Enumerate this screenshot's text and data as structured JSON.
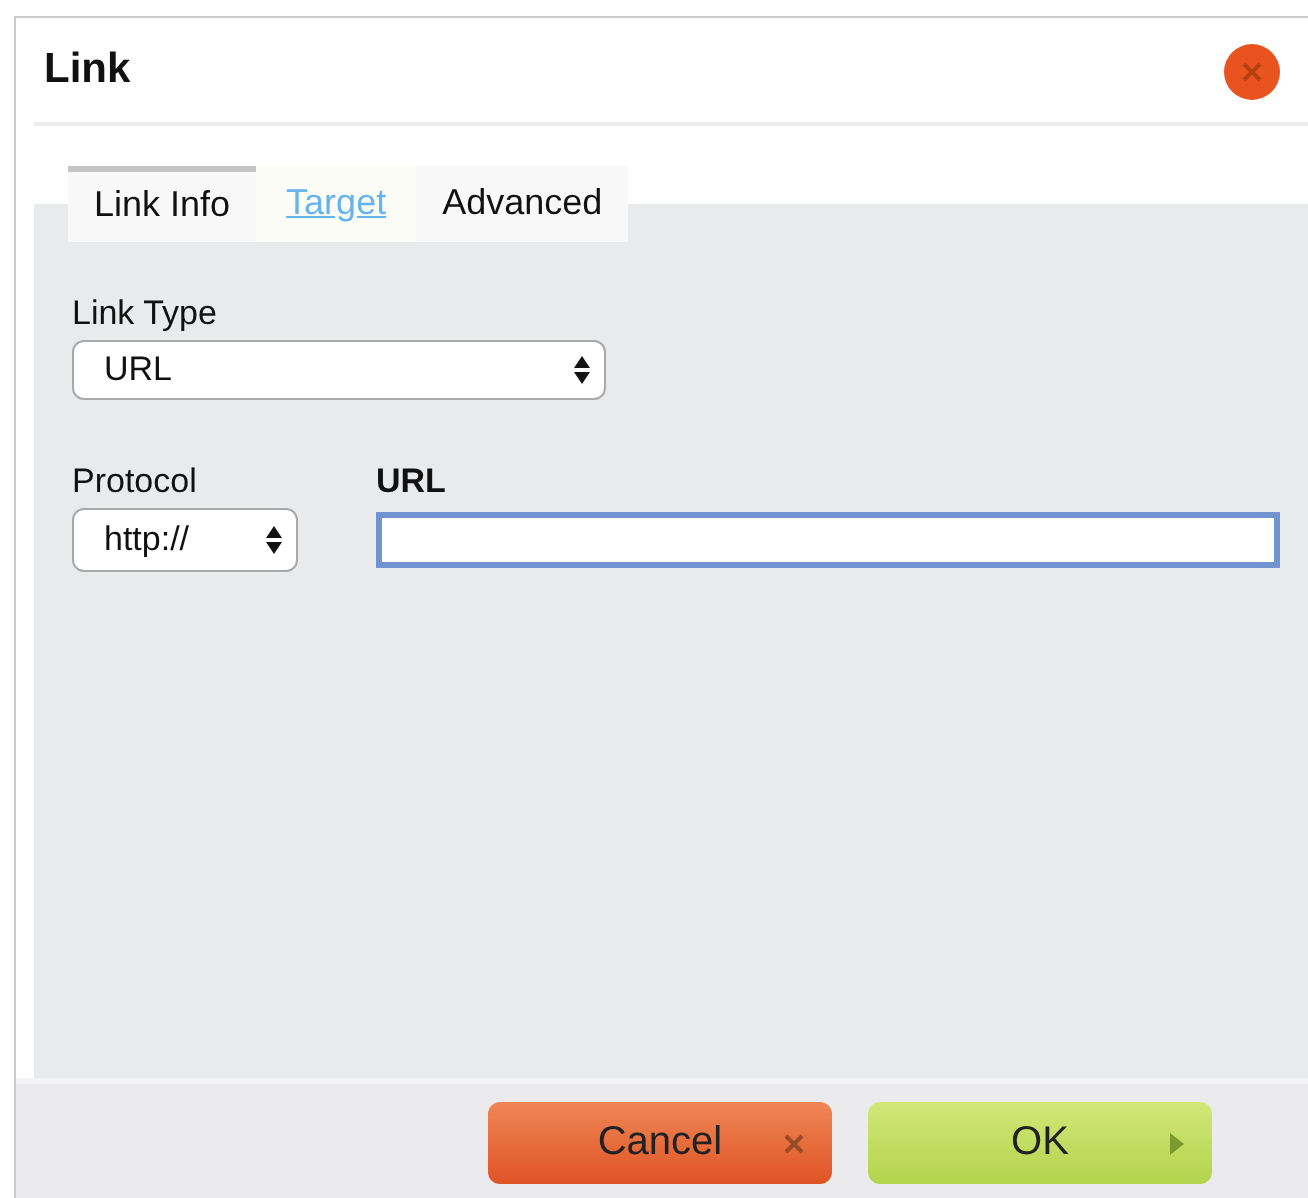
{
  "dialog": {
    "title": "Link"
  },
  "tabs": [
    {
      "label": "Link Info",
      "selected": true,
      "hovered": false
    },
    {
      "label": "Target",
      "selected": false,
      "hovered": true
    },
    {
      "label": "Advanced",
      "selected": false,
      "hovered": false
    }
  ],
  "link_type": {
    "label": "Link Type",
    "value": "URL"
  },
  "protocol": {
    "label": "Protocol",
    "value": "http://"
  },
  "url": {
    "label": "URL",
    "focused": true
  },
  "buttons": [
    {
      "label": "Cancel",
      "kind": "cancel"
    },
    {
      "label": "OK",
      "kind": "ok"
    }
  ]
}
